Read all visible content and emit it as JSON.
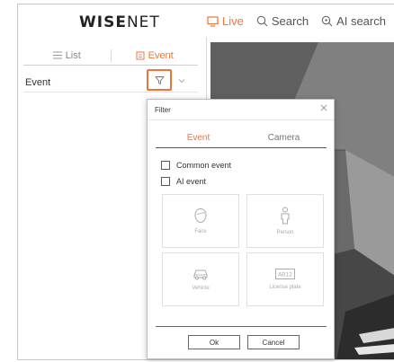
{
  "header": {
    "logo_bold": "WISE",
    "logo_light": "NET",
    "nav": [
      {
        "label": "Live",
        "icon": "monitor-icon",
        "active": true
      },
      {
        "label": "Search",
        "icon": "search-icon",
        "active": false
      },
      {
        "label": "AI search",
        "icon": "ai-search-icon",
        "active": false
      }
    ]
  },
  "sidebar": {
    "tabs": [
      {
        "label": "List",
        "icon": "list-icon",
        "active": false
      },
      {
        "label": "Event",
        "icon": "event-icon",
        "active": true
      }
    ],
    "event_row_label": "Event"
  },
  "filter_dialog": {
    "title": "Filter",
    "tabs": [
      {
        "label": "Event",
        "active": true
      },
      {
        "label": "Camera",
        "active": false
      }
    ],
    "checkboxes": [
      {
        "label": "Common event",
        "checked": false
      },
      {
        "label": "AI event",
        "checked": false
      }
    ],
    "tiles": [
      {
        "label": "Face",
        "icon": "face-icon"
      },
      {
        "label": "Person",
        "icon": "person-icon"
      },
      {
        "label": "Vehicle",
        "icon": "vehicle-icon"
      },
      {
        "label": "License plate",
        "icon": "license-plate-icon",
        "plate_text": "AB12"
      }
    ],
    "ok_label": "Ok",
    "cancel_label": "Cancel"
  },
  "colors": {
    "accent": "#f0733a",
    "border": "#c9c9c9",
    "camera_bg": "#6f6f6f"
  }
}
